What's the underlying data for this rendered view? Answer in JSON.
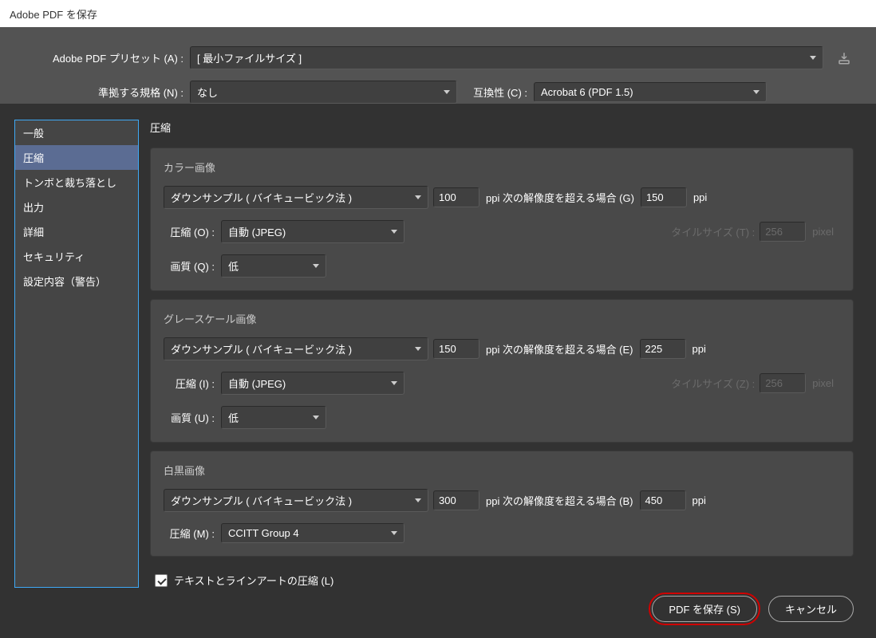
{
  "window": {
    "title": "Adobe PDF を保存"
  },
  "top": {
    "preset_label": "Adobe PDF プリセット (A) :",
    "preset_value": "[ 最小ファイルサイズ ]",
    "standard_label": "準拠する規格 (N) :",
    "standard_value": "なし",
    "compat_label": "互換性 (C) :",
    "compat_value": "Acrobat 6 (PDF 1.5)"
  },
  "sidebar": {
    "items": [
      "一般",
      "圧縮",
      "トンボと裁ち落とし",
      "出力",
      "詳細",
      "セキュリティ",
      "設定内容（警告）"
    ],
    "selected_index": 1
  },
  "panel": {
    "title": "圧縮",
    "color": {
      "title": "カラー画像",
      "downsample": "ダウンサンプル ( バイキュービック法 )",
      "ppi1": "100",
      "ppi_label": "ppi 次の解像度を超える場合 (G)",
      "ppi2": "150",
      "ppi_unit": "ppi",
      "comp_label": "圧縮 (O) :",
      "comp_value": "自動 (JPEG)",
      "tile_label": "タイルサイズ (T) :",
      "tile_value": "256",
      "tile_unit": "pixel",
      "quality_label": "画質 (Q) :",
      "quality_value": "低"
    },
    "gray": {
      "title": "グレースケール画像",
      "downsample": "ダウンサンプル ( バイキュービック法 )",
      "ppi1": "150",
      "ppi_label": "ppi 次の解像度を超える場合 (E)",
      "ppi2": "225",
      "ppi_unit": "ppi",
      "comp_label": "圧縮 (I) :",
      "comp_value": "自動 (JPEG)",
      "tile_label": "タイルサイズ (Z) :",
      "tile_value": "256",
      "tile_unit": "pixel",
      "quality_label": "画質 (U) :",
      "quality_value": "低"
    },
    "mono": {
      "title": "白黒画像",
      "downsample": "ダウンサンプル ( バイキュービック法 )",
      "ppi1": "300",
      "ppi_label": "ppi 次の解像度を超える場合 (B)",
      "ppi2": "450",
      "ppi_unit": "ppi",
      "comp_label": "圧縮 (M) :",
      "comp_value": "CCITT Group 4"
    },
    "text_compress_label": "テキストとラインアートの圧縮 (L)"
  },
  "footer": {
    "save": "PDF を保存 (S)",
    "cancel": "キャンセル"
  }
}
